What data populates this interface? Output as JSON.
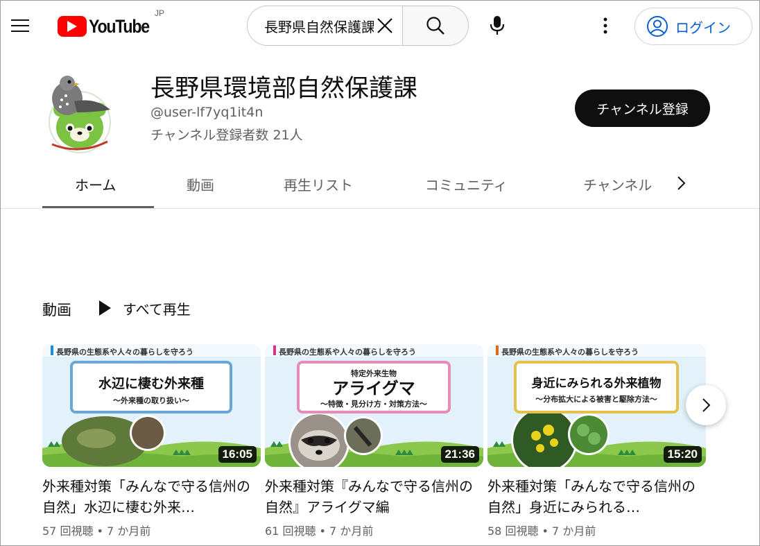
{
  "header": {
    "logo_text": "YouTube",
    "region": "JP",
    "search_value": "長野県自然保護課",
    "login_label": "ログイン",
    "colors": {
      "logo_red": "#ff0000",
      "link_blue": "#065fd4"
    }
  },
  "channel": {
    "name": "長野県環境部自然保護課",
    "handle": "@user-lf7yq1it4n",
    "subscribers": "チャンネル登録者数 21人",
    "subscribe_label": "チャンネル登録"
  },
  "tabs": [
    {
      "label": "ホーム",
      "active": true
    },
    {
      "label": "動画",
      "active": false
    },
    {
      "label": "再生リスト",
      "active": false
    },
    {
      "label": "コミュニティ",
      "active": false
    },
    {
      "label": "チャンネル",
      "active": false
    }
  ],
  "shelf": {
    "title": "動画",
    "play_all_label": "すべて再生"
  },
  "videos": [
    {
      "thumb_banner": "長野県の生態系や人々の暮らしを守ろう",
      "thumb_sub": "",
      "thumb_title": "水辺に棲む外来種",
      "thumb_caption": "〜外来種の取り扱い〜",
      "accent": "#1a8fd6",
      "duration": "16:05",
      "title": "外来種対策「みんなで守る信州の自然」水辺に棲む外来…",
      "meta": "57 回視聴 • 7 か月前"
    },
    {
      "thumb_banner": "長野県の生態系や人々の暮らしを守ろう",
      "thumb_sub": "特定外来生物",
      "thumb_title": "アライグマ",
      "thumb_caption": "〜特徴・見分け方・対策方法〜",
      "accent": "#d6338a",
      "duration": "21:36",
      "title": "外来種対策『みんなで守る信州の自然』アライグマ編",
      "meta": "61 回視聴 • 7 か月前"
    },
    {
      "thumb_banner": "長野県の生態系や人々の暮らしを守ろう",
      "thumb_sub": "",
      "thumb_title": "身近にみられる外来植物",
      "thumb_caption": "〜分布拡大による被害と駆除方法〜",
      "accent": "#e06a1a",
      "duration": "15:20",
      "title": "外来種対策「みんなで守る信州の自然」身近にみられる…",
      "meta": "58 回視聴 • 7 か月前"
    }
  ]
}
